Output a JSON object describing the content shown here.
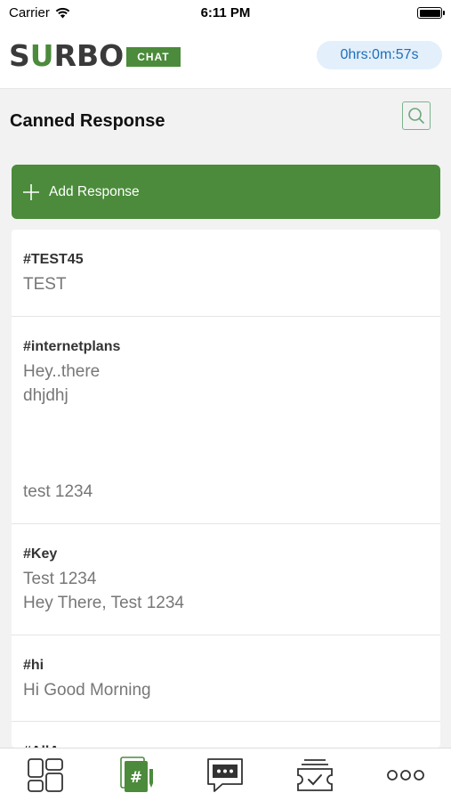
{
  "status_bar": {
    "carrier": "Carrier",
    "time": "6:11 PM"
  },
  "header": {
    "logo_text_prefix": "S",
    "logo_text_u": "U",
    "logo_text_suffix": "RBO",
    "logo_badge": "CHAT",
    "timer": "0hrs:0m:57s"
  },
  "page": {
    "title": "Canned Response",
    "add_button_label": "Add Response"
  },
  "responses": [
    {
      "key": "#TEST45",
      "lines": [
        "TEST"
      ]
    },
    {
      "key": "#internetplans",
      "lines": [
        "Hey..there",
        "dhjdhj",
        "",
        "",
        "",
        "test 1234"
      ]
    },
    {
      "key": "#Key",
      "lines": [
        "Test 1234",
        "Hey There, Test 1234"
      ]
    },
    {
      "key": "#hi",
      "lines": [
        "Hi Good Morning"
      ]
    },
    {
      "key": "#AllAnswers",
      "lines": []
    }
  ],
  "tabs": [
    {
      "name": "dashboard-icon",
      "active": false
    },
    {
      "name": "canned-response-icon",
      "active": true
    },
    {
      "name": "chat-icon",
      "active": false
    },
    {
      "name": "tickets-icon",
      "active": false
    },
    {
      "name": "more-icon",
      "active": false
    }
  ],
  "colors": {
    "brand_green": "#4b8b3b",
    "timer_bg": "#e3effb",
    "timer_text": "#1f6fb7"
  }
}
